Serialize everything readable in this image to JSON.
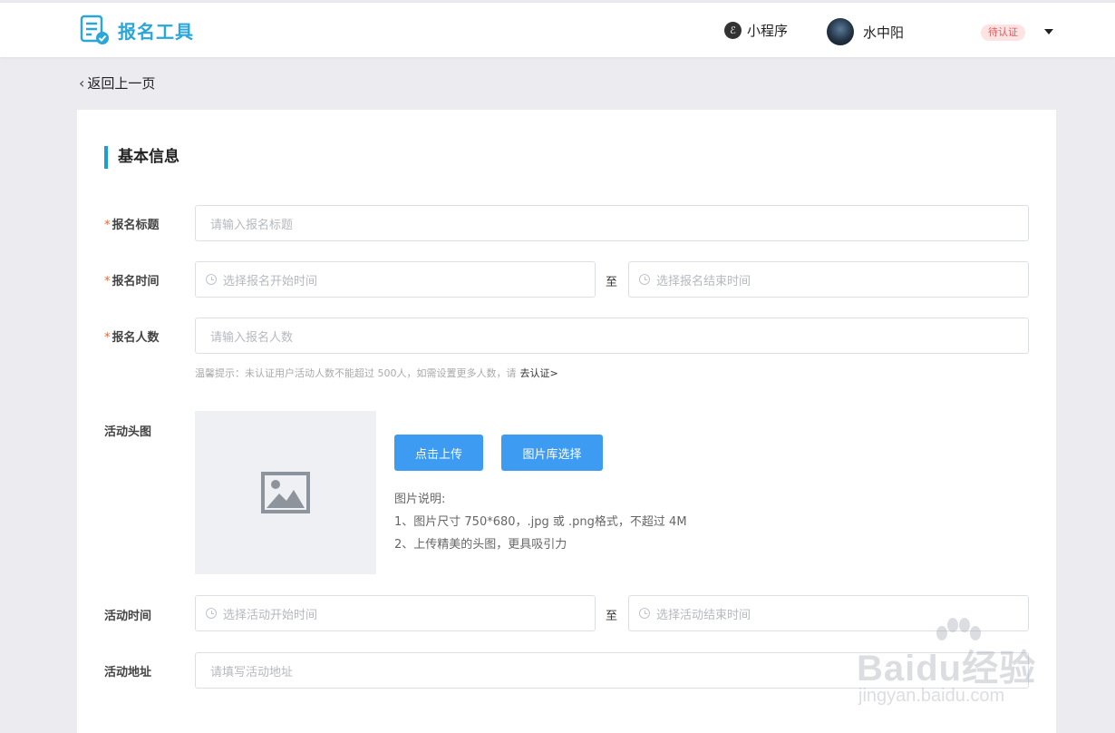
{
  "header": {
    "logo_text": "报名工具",
    "mini_program": "小程序",
    "user_name": "水中阳",
    "auth_badge": "待认证"
  },
  "back_label": "返回上一页",
  "section_title": "基本信息",
  "form": {
    "title_label": "报名标题",
    "title_placeholder": "请输入报名标题",
    "time_label": "报名时间",
    "time_start_placeholder": "选择报名开始时间",
    "time_sep": "至",
    "time_end_placeholder": "选择报名结束时间",
    "count_label": "报名人数",
    "count_placeholder": "请输入报名人数",
    "hint_text": "温馨提示：未认证用户活动人数不能超过 500人，如需设置更多人数，请",
    "hint_link": "去认证>",
    "image_label": "活动头图",
    "upload_button": "点击上传",
    "library_button": "图片库选择",
    "image_desc_title": "图片说明:",
    "image_desc_1": "1、图片尺寸 750*680，.jpg 或 .png格式，不超过 4M",
    "image_desc_2": "2、上传精美的头图，更具吸引力",
    "activity_time_label": "活动时间",
    "activity_start_placeholder": "选择活动开始时间",
    "activity_sep": "至",
    "activity_end_placeholder": "选择活动结束时间",
    "address_label": "活动地址",
    "address_placeholder": "请填写活动地址"
  },
  "watermark": {
    "brand": "Baidu经验",
    "url": "jingyan.baidu.com"
  },
  "colors": {
    "accent": "#2aa6d8",
    "button": "#3d9cf2",
    "required": "#e7663b",
    "badge_bg": "#fde3e3",
    "badge_text": "#e05b5b"
  }
}
